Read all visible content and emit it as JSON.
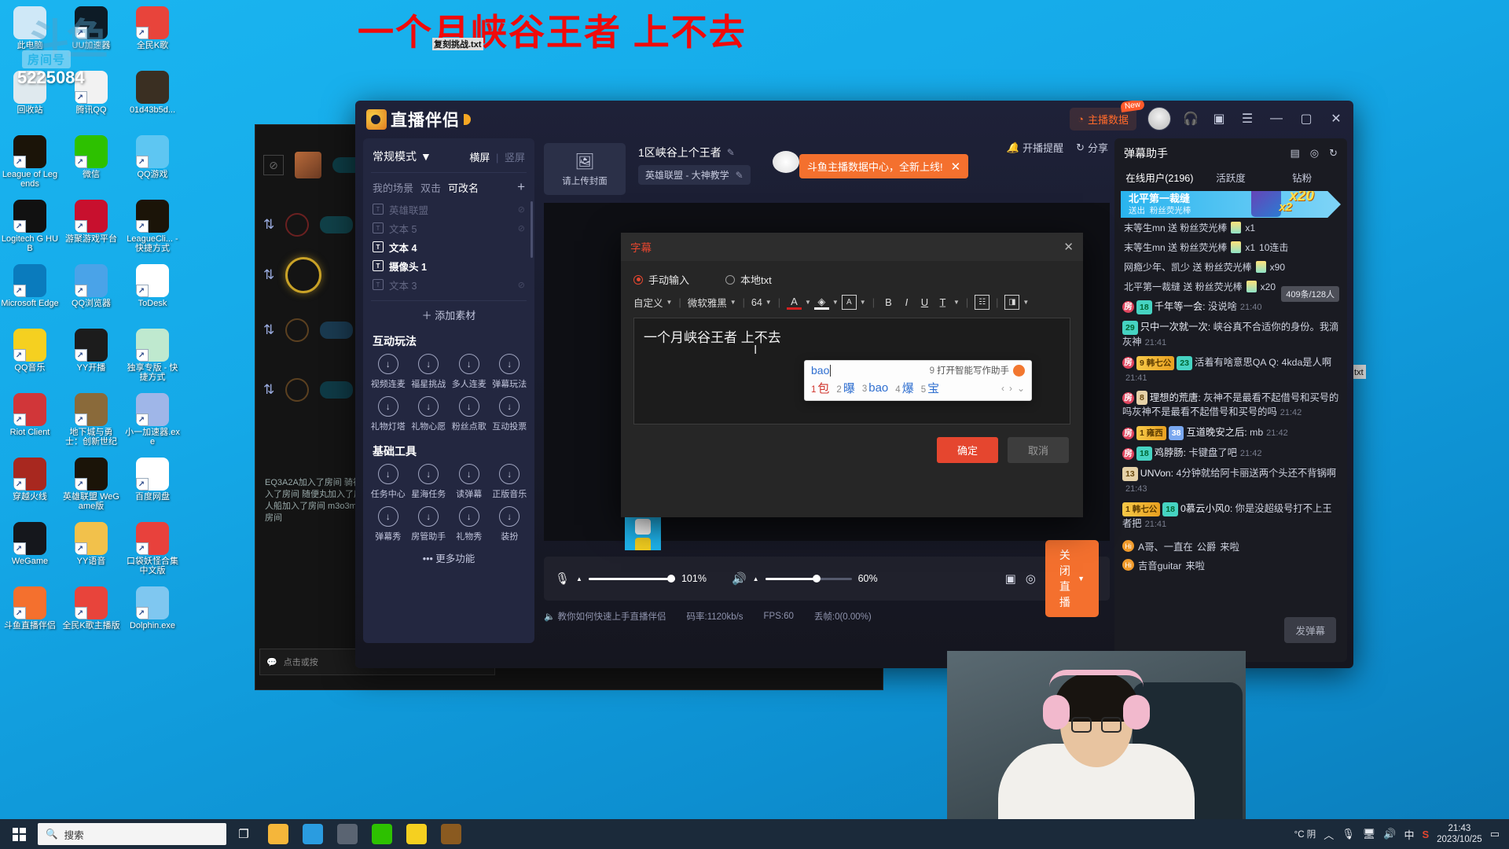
{
  "desktop": {
    "watermark": "斗鱼",
    "room_tag": "房间号",
    "room_number": "5225084",
    "big_title": "一个月峡谷王者 上不去",
    "txt_file": "复刻挑战.txt",
    "txt_file_right": "战.txt",
    "icons": [
      {
        "label": "此电脑",
        "icon": "computer-icon",
        "color": "#cfe8f7",
        "shortcut": false
      },
      {
        "label": "UU加速器",
        "icon": "uu-booster-icon",
        "color": "#0d1b26",
        "shortcut": true
      },
      {
        "label": "全民K歌",
        "icon": "kge-icon",
        "color": "#e8443b",
        "shortcut": true
      },
      {
        "label": "回收站",
        "icon": "recycle-bin-icon",
        "color": "#dfe9ee",
        "shortcut": false
      },
      {
        "label": "腾讯QQ",
        "icon": "qq-icon",
        "color": "#f2f2f2",
        "shortcut": true
      },
      {
        "label": "01d43b5d...",
        "icon": "image-file-icon",
        "color": "#3a2f22",
        "shortcut": false
      },
      {
        "label": "League of Legends",
        "icon": "lol-icon",
        "color": "#1b1408",
        "shortcut": true
      },
      {
        "label": "微信",
        "icon": "wechat-icon",
        "color": "#2dc100",
        "shortcut": true
      },
      {
        "label": "QQ游戏",
        "icon": "qq-games-icon",
        "color": "#5ec6f2",
        "shortcut": true
      },
      {
        "label": "Logitech G HUB",
        "icon": "logitech-ghub-icon",
        "color": "#111111",
        "shortcut": true
      },
      {
        "label": "游聚游戏平台",
        "icon": "youju-icon",
        "color": "#c8102e",
        "shortcut": true
      },
      {
        "label": "LeagueCli... - 快捷方式",
        "icon": "league-client-icon",
        "color": "#1b1408",
        "shortcut": true
      },
      {
        "label": "Microsoft Edge",
        "icon": "edge-icon",
        "color": "#0a7bbd",
        "shortcut": true
      },
      {
        "label": "QQ浏览器",
        "icon": "qq-browser-icon",
        "color": "#4aa3e8",
        "shortcut": true
      },
      {
        "label": "ToDesk",
        "icon": "todesk-icon",
        "color": "#ffffff",
        "shortcut": true
      },
      {
        "label": "QQ音乐",
        "icon": "qq-music-icon",
        "color": "#f5d020",
        "shortcut": true
      },
      {
        "label": "YY开播",
        "icon": "yy-live-icon",
        "color": "#1c1c1c",
        "shortcut": true
      },
      {
        "label": "独享专版 - 快捷方式",
        "icon": "exclusive-edition-icon",
        "color": "#bfe9cf",
        "shortcut": true
      },
      {
        "label": "Riot Client",
        "icon": "riot-client-icon",
        "color": "#d13639",
        "shortcut": true
      },
      {
        "label": "地下城与勇士：创新世纪",
        "icon": "dnf-icon",
        "color": "#8a6a3a",
        "shortcut": true
      },
      {
        "label": "小一加速器.exe",
        "icon": "xiaoyi-booster-icon",
        "color": "#9fb6e8",
        "shortcut": true
      },
      {
        "label": "穿越火线",
        "icon": "crossfire-icon",
        "color": "#a8281f",
        "shortcut": true
      },
      {
        "label": "英雄联盟 WeGame版",
        "icon": "lol-wegame-icon",
        "color": "#1b1408",
        "shortcut": true
      },
      {
        "label": "百度网盘",
        "icon": "baidu-netdisk-icon",
        "color": "#ffffff",
        "shortcut": true
      },
      {
        "label": "WeGame",
        "icon": "wegame-icon",
        "color": "#15171c",
        "shortcut": true
      },
      {
        "label": "YY语音",
        "icon": "yy-voice-icon",
        "color": "#f2c14b",
        "shortcut": true
      },
      {
        "label": "口袋妖怪合集中文版",
        "icon": "pokeball-icon",
        "color": "#e8413c",
        "shortcut": true
      },
      {
        "label": "斗鱼直播伴侣",
        "icon": "douyu-companion-icon",
        "color": "#f4702e",
        "shortcut": true
      },
      {
        "label": "全民K歌主播版",
        "icon": "kge-anchor-icon",
        "color": "#e8443b",
        "shortcut": true
      },
      {
        "label": "Dolphin.exe",
        "icon": "dolphin-icon",
        "color": "#7fc7f0",
        "shortcut": true
      }
    ]
  },
  "obs": {
    "overlay_text": "EQ3A2A加入了房间 骑神游戏加入了房间 随便丸加入了房间 双人船加入了房间 m3o3m加入了房间",
    "chat_placeholder": "点击或按"
  },
  "app": {
    "brand": "直播伴侣",
    "header": {
      "data_button": "主播数据",
      "new_badge": "New",
      "headset_icon": "headset-icon",
      "help_icon": "help-icon",
      "menu_icon": "hamburger-menu-icon",
      "minimize": "—",
      "maximize": "▢",
      "close": "✕"
    },
    "subheader": {
      "reminder": "开播提醒",
      "share": "分享"
    },
    "promo": {
      "text": "斗鱼主播数据中心，全新上线!",
      "close": "✕"
    },
    "left_panel": {
      "mode": "常规模式",
      "landscape": "横屏",
      "portrait": "竖屏",
      "scene_label": "我的场景",
      "scene_hint1": "双击",
      "scene_hint2": "可改名",
      "add_scene": "+",
      "scenes": [
        {
          "name": "英雄联盟",
          "icon": "gamepad-icon",
          "active": false,
          "hidden": true
        },
        {
          "name": "文本 5",
          "icon": "text-icon",
          "active": false,
          "hidden": true
        },
        {
          "name": "文本 4",
          "icon": "text-icon",
          "active": true,
          "hidden": false
        },
        {
          "name": "摄像头 1",
          "icon": "camera-icon",
          "active": true,
          "hidden": false
        },
        {
          "name": "文本 3",
          "icon": "text-icon",
          "active": false,
          "hidden": true
        }
      ],
      "add_material": "添加素材",
      "interactive_title": "互动玩法",
      "interactive_tools": [
        {
          "label": "视频连麦",
          "icon": "video-mic-icon"
        },
        {
          "label": "福星挑战",
          "icon": "shield-star-icon"
        },
        {
          "label": "多人连麦",
          "icon": "multi-mic-icon"
        },
        {
          "label": "弹幕玩法",
          "icon": "download-icon"
        },
        {
          "label": "礼物灯塔",
          "icon": "download-icon"
        },
        {
          "label": "礼物心愿",
          "icon": "download-icon"
        },
        {
          "label": "粉丝点歌",
          "icon": "music-note-icon"
        },
        {
          "label": "互动投票",
          "icon": "download-icon"
        }
      ],
      "basic_title": "基础工具",
      "basic_tools": [
        {
          "label": "任务中心",
          "icon": "shop-icon"
        },
        {
          "label": "星海任务",
          "icon": "ad-icon"
        },
        {
          "label": "读弹幕",
          "icon": "read-danmaku-icon"
        },
        {
          "label": "正版音乐",
          "icon": "download-icon"
        },
        {
          "label": "弹幕秀",
          "icon": "danmaku-show-icon"
        },
        {
          "label": "房管助手",
          "icon": "home-icon"
        },
        {
          "label": "礼物秀",
          "icon": "gift-show-icon"
        },
        {
          "label": "装扮",
          "icon": "emoji-icon"
        }
      ],
      "more": "更多功能"
    },
    "cover": {
      "upload_text": "请上传封面",
      "upload_icon": "image-upload-icon"
    },
    "room": {
      "title": "1区峡谷上个王者",
      "category": "英雄联盟 - 大神教学",
      "edit_icon": "pencil-icon"
    },
    "bottom_bar": {
      "mic_icon": "microphone-icon",
      "mic_value": "101%",
      "speaker_icon": "speaker-muted-icon",
      "speaker_value": "60%",
      "record_icon": "record-video-icon",
      "settings_icon": "target-icon",
      "stop_label": "关闭直播"
    },
    "status": {
      "tip": "教你如何快速上手直播伴侣",
      "bitrate": "码率:1120kb/s",
      "fps": "FPS:60",
      "dropped": "丢帧:0(0.00%)"
    }
  },
  "chat": {
    "title": "弹幕助手",
    "icons": [
      "panel-icon",
      "target-icon",
      "refresh-icon"
    ],
    "tabs": [
      {
        "label": "在线用户(2196)",
        "active": true
      },
      {
        "label": "活跃度",
        "active": false
      },
      {
        "label": "钻粉",
        "active": false
      }
    ],
    "gift_banner": {
      "user": "北平第一裁缝",
      "action": "送出",
      "gift": "粉丝荧光棒",
      "combo1": "x20",
      "combo2": "x2"
    },
    "gift_rows": [
      {
        "text": "末等生mn 送 粉丝荧光棒",
        "count": "x1",
        "extra": ""
      },
      {
        "text": "末等生mn 送 粉丝荧光棒",
        "count": "x1",
        "extra": "10连击"
      },
      {
        "text": "网瘾少年、凯少 送 粉丝荧光棒",
        "count": "x90",
        "extra": ""
      },
      {
        "text": "北平第一裁缝 送 粉丝荧光棒",
        "count": "x20",
        "extra": ""
      }
    ],
    "message_count": "409条/128人",
    "messages": [
      {
        "badges": [
          {
            "text": "房",
            "type": "fang"
          },
          {
            "text": "18",
            "type": "teal"
          }
        ],
        "name": "千年等一会:",
        "text": "没说啥",
        "time": "21:40"
      },
      {
        "badges": [
          {
            "text": "29",
            "type": "teal"
          }
        ],
        "name": "只中一次就一次:",
        "text": "峡谷真不合适你的身份。我滴灰神",
        "time": "21:41"
      },
      {
        "badges": [
          {
            "text": "房",
            "type": "fang"
          },
          {
            "text": "9 韩七公",
            "type": "gold"
          },
          {
            "text": "23",
            "type": "teal"
          }
        ],
        "name": "",
        "text": "活着有啥意思QA Q: 4kda是人啊",
        "time": "21:41"
      },
      {
        "badges": [
          {
            "text": "房",
            "type": "fang"
          },
          {
            "text": "8",
            "type": "tan"
          }
        ],
        "name": "理想的荒唐:",
        "text": "灰神不是最看不起借号和买号的吗灰神不是最看不起借号和买号的吗",
        "time": "21:42"
      },
      {
        "badges": [
          {
            "text": "房",
            "type": "fang"
          },
          {
            "text": "1 雍西",
            "type": "gold"
          },
          {
            "text": "38",
            "type": "blue"
          }
        ],
        "name": "互道晚安之后:",
        "text": "mb",
        "time": "21:42"
      },
      {
        "badges": [
          {
            "text": "房",
            "type": "fang"
          },
          {
            "text": "18",
            "type": "teal"
          }
        ],
        "name": "鸡脖肠:",
        "text": "卡键盘了吧",
        "time": "21:42"
      },
      {
        "badges": [
          {
            "text": "13",
            "type": "tan"
          }
        ],
        "name": "UNVon:",
        "text": "4分钟就给阿卡丽送两个头还不背锅啊",
        "time": "21:43"
      },
      {
        "badges": [
          {
            "text": "1 韩七公",
            "type": "gold"
          },
          {
            "text": "18",
            "type": "teal"
          }
        ],
        "name": "0慕云小风0:",
        "text": "你是没超级号打不上王者把",
        "time": "21:41"
      }
    ],
    "joins": [
      {
        "name": "A哥、一直在",
        "highlight": "公爵",
        "suffix": "来啦"
      },
      {
        "name": "吉音guitar",
        "highlight": "",
        "suffix": "来啦"
      }
    ],
    "send_button": "发弹幕"
  },
  "subtitle_dialog": {
    "title": "字幕",
    "close_icon": "close-icon",
    "radio_manual": "手动输入",
    "radio_file": "本地txt",
    "radio_selected": "手动输入",
    "toolbar": {
      "preset": "自定义",
      "font": "微软雅黑",
      "size": "64",
      "font_color_icon": "font-color-icon",
      "highlight_icon": "highlight-color-icon",
      "border_icon": "text-border-icon",
      "bold": "B",
      "italic": "I",
      "underline": "U",
      "strike_icon": "text-style-icon",
      "align_icon": "align-icon",
      "effect_icon": "text-effect-icon"
    },
    "text_value": "一个月峡谷王者 上不去",
    "confirm": "确定",
    "cancel": "取消"
  },
  "ime": {
    "composition": "bao",
    "hint_number": "9",
    "hint_text": "打开智能写作助手",
    "assistant_icon": "ai-assistant-icon",
    "candidates": [
      {
        "num": "1",
        "word": "包"
      },
      {
        "num": "2",
        "word": "曝"
      },
      {
        "num": "3",
        "word": "bao"
      },
      {
        "num": "4",
        "word": "爆"
      },
      {
        "num": "5",
        "word": "宝"
      }
    ],
    "nav_prev": "‹",
    "nav_next": "›",
    "nav_expand": "⌄"
  },
  "taskbar": {
    "start_icon": "windows-start-icon",
    "search_placeholder": "搜索",
    "search_icon": "search-icon",
    "taskview_icon": "task-view-icon",
    "apps": [
      {
        "name": "file-explorer-icon",
        "color": "#f5b63a"
      },
      {
        "name": "qq-browser-icon",
        "color": "#2a9ce0"
      },
      {
        "name": "youju-icon",
        "color": "#5a6472"
      },
      {
        "name": "wechat-icon",
        "color": "#2dc100"
      },
      {
        "name": "qq-music-icon",
        "color": "#f5d020"
      },
      {
        "name": "lol-icon",
        "color": "#8a5a20"
      }
    ],
    "tray": {
      "temperature": "°C 阴",
      "chevron": "︿",
      "mic_icon": "microphone-icon",
      "network_icon": "monitor-icon",
      "volume_icon": "volume-icon",
      "ime_icon": "中",
      "sogou_icon": "sogou-icon",
      "time": "21:43",
      "date": "2023/10/25",
      "notify_icon": "notification-icon"
    }
  }
}
